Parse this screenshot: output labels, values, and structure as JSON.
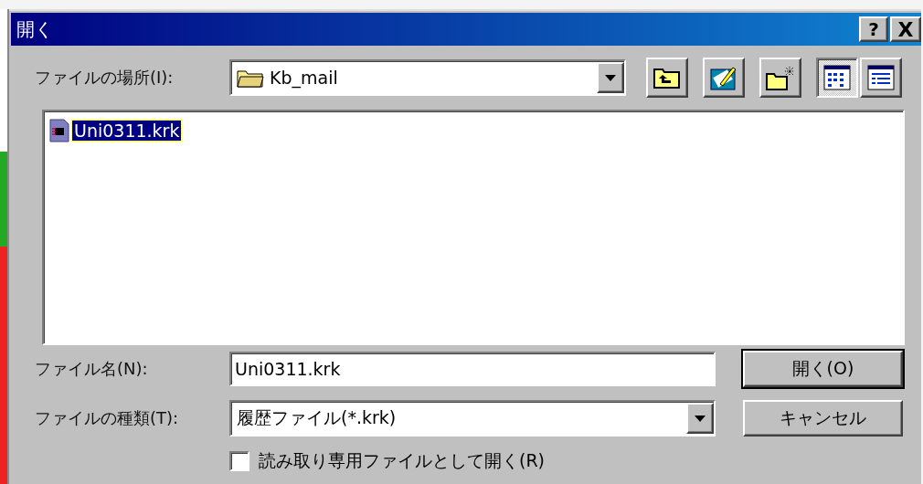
{
  "window": {
    "title": "開く",
    "title_buttons": [
      {
        "kind": "help",
        "label": "?"
      },
      {
        "kind": "close",
        "label": "X"
      }
    ]
  },
  "look_in": {
    "label": "ファイルの場所(I):",
    "value": "Kb_mail"
  },
  "toolbar": [
    {
      "kind": "up"
    },
    {
      "kind": "edit"
    },
    {
      "kind": "new_folder"
    },
    {
      "kind": "list_view",
      "selected": true
    },
    {
      "kind": "details_view",
      "selected": false
    }
  ],
  "files": [
    {
      "name": "Uni0311.krk",
      "selected": true
    }
  ],
  "file_name": {
    "label": "ファイル名(N):",
    "value": "Uni0311.krk"
  },
  "file_type": {
    "label": "ファイルの種類(T):",
    "value": "履歴ファイル(*.krk)"
  },
  "read_only": {
    "label": "読み取り専用ファイルとして開く(R)",
    "checked": false
  },
  "buttons": [
    {
      "label": "開く(O)",
      "default": true
    },
    {
      "label": "キャンセル",
      "default": false
    }
  ]
}
